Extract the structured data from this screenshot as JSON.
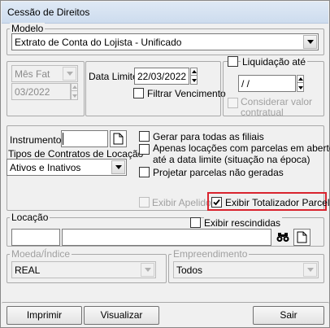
{
  "window": {
    "title": "Cessão de Direitos"
  },
  "modelo": {
    "group_label": "Modelo",
    "selected": "Extrato de Conta do Lojista - Unificado"
  },
  "periodo": {
    "tipo_selected": "Mês Fat",
    "mes_value": "03/2022"
  },
  "data_limite": {
    "label": "Data Limite",
    "value": "22/03/2022",
    "filtrar_vencimento_label": "Filtrar Vencimento",
    "filtrar_vencimento_checked": false
  },
  "liquidacao": {
    "label": "Liquidação até",
    "checked": false,
    "date_value": " / /",
    "considerar_label_line1": "Considerar valor",
    "considerar_label_line2": "contratual"
  },
  "options": {
    "instrumento_label": "Instrumento",
    "instrumento_value": "",
    "tipos_label": "Tipos de Contratos de Locação",
    "tipos_selected": "Ativos e Inativos",
    "gerar_filiais_label": "Gerar para todas as filiais",
    "apenas_locacoes_line1": "Apenas locações com parcelas em aberto",
    "apenas_locacoes_line2": "até a data limite (situação na época)",
    "projetar_label": "Projetar parcelas não geradas",
    "exibir_apelido_label": "Exibir Apelido",
    "exibir_totalizador_label": "Exibir Totalizador Parcela",
    "exibir_totalizador_checked": true
  },
  "locacao": {
    "group_label": "Locação",
    "exibir_rescindidas_label": "Exibir rescindidas",
    "codigo_value": "",
    "nome_value": ""
  },
  "moeda": {
    "group_label": "Moeda/Índice",
    "selected": "REAL"
  },
  "empreendimento": {
    "group_label": "Empreendimento",
    "selected": "Todos"
  },
  "buttons": {
    "imprimir": "Imprimir",
    "visualizar": "Visualizar",
    "sair": "Sair"
  },
  "colors": {
    "highlight": "#d9232e",
    "titlebar": "#d6e3f2"
  },
  "icons": [
    "new-document-icon",
    "binoculars-icon",
    "check-icon",
    "dropdown-arrow-icon"
  ]
}
